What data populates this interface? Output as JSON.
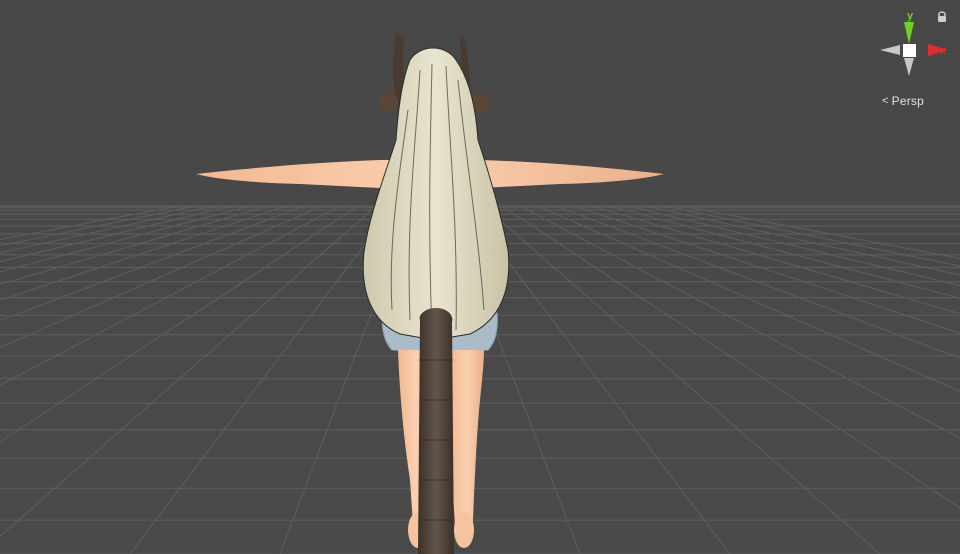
{
  "viewport": {
    "projection_label": "Persp",
    "icons": {
      "projection": "perspective-chevron-icon",
      "lock": "lock-icon"
    }
  },
  "gizmo": {
    "y_axis_label": "y",
    "x_axis_label": "x",
    "colors": {
      "y_axis": "#6fd121",
      "x_axis": "#e02c2c",
      "neutral_axis": "#c8c8c8",
      "center": "#ffffff"
    }
  },
  "scene": {
    "background": "#484848",
    "grid_color": "#5e5e5e"
  }
}
